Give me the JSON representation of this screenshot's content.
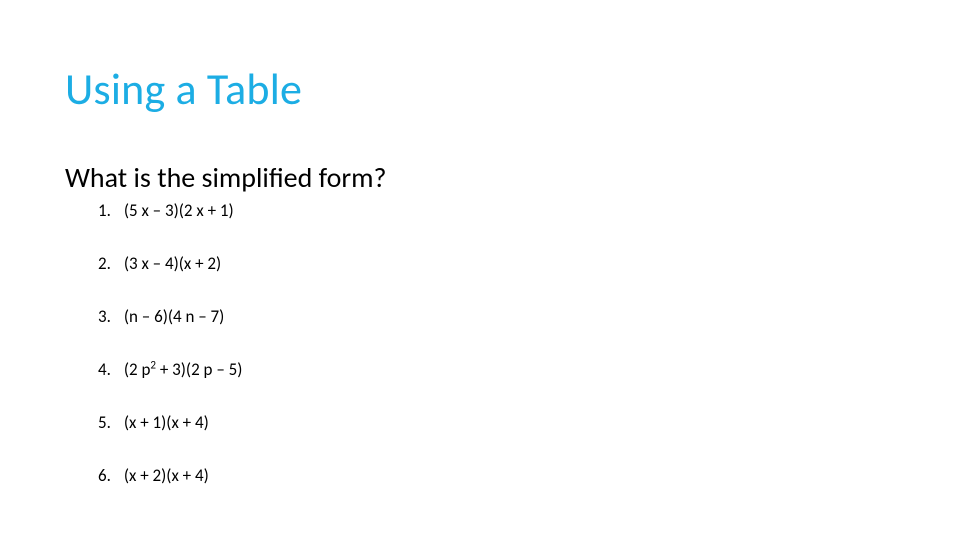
{
  "title": "Using a Table",
  "subtitle": "What is the simplified form?",
  "items": [
    {
      "num": "1.",
      "expr": "(5 x – 3)(2 x + 1)"
    },
    {
      "num": "2.",
      "expr": "(3 x – 4)(x + 2)"
    },
    {
      "num": "3.",
      "expr": "(n – 6)(4 n – 7)"
    },
    {
      "num": "4.",
      "expr_html": "(2 p<sup>2</sup> + 3)(2 p – 5)"
    },
    {
      "num": "5.",
      "expr": "(x + 1)(x + 4)"
    },
    {
      "num": "6.",
      "expr": "(x + 2)(x + 4)"
    }
  ]
}
